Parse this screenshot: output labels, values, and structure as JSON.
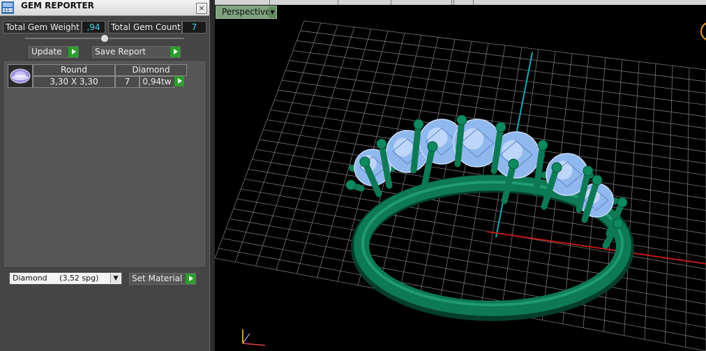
{
  "panel": {
    "title": "GEM REPORTER",
    "close_glyph": "×",
    "total_weight_label": "Total Gem Weight",
    "total_weight_value": ",94",
    "total_count_label": "Total Gem Count",
    "total_count_value": "7",
    "update_label": "Update",
    "save_report_label": "Save Report",
    "gems": [
      {
        "shape": "Round",
        "material": "Diamond",
        "size": "3,30 X 3,30",
        "count": "7",
        "weight": "0,94tw"
      }
    ],
    "material_select": {
      "value": "Diamond     (3,52 spg)"
    },
    "set_material_label": "Set Material"
  },
  "viewport": {
    "view_mode": "Perspective"
  },
  "colors": {
    "accent_green": "#2d9d2d",
    "value_cyan": "#44d7ee",
    "ring_green": "#0d7a55",
    "gem_blue": "#8fb8ee",
    "grid": "#8a8a8a",
    "axis_y": "#1fa8b8",
    "axis_x": "#c01a1a"
  },
  "icons": [
    "gem-reporter-app-icon",
    "close-icon",
    "arrow-right-icon",
    "dropdown-arrow-icon",
    "round-gem-icon",
    "axis-gizmo-icon"
  ]
}
